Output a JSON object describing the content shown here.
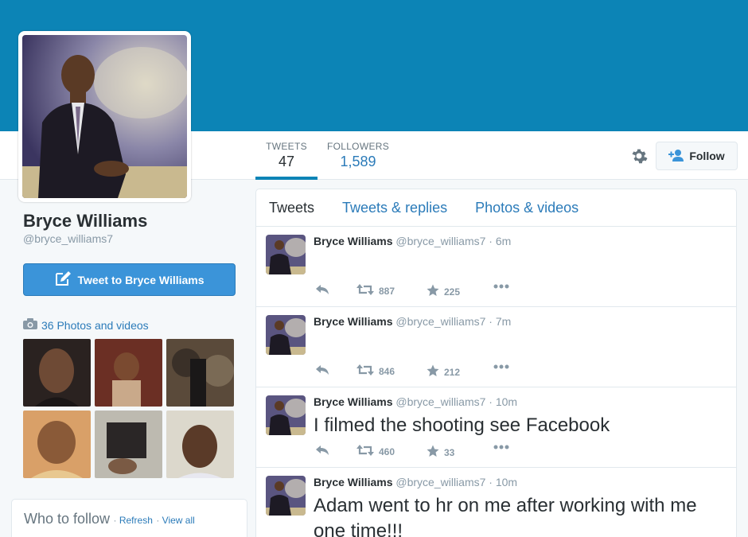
{
  "colors": {
    "banner": "#0c84b6",
    "link": "#2b7bb9",
    "button": "#3b94d9"
  },
  "stats": [
    {
      "label": "TWEETS",
      "value": "47"
    },
    {
      "label": "FOLLOWERS",
      "value": "1,589"
    }
  ],
  "follow_label": "Follow",
  "profile": {
    "name": "Bryce Williams",
    "handle": "@bryce_williams7",
    "tweet_to_label": "Tweet to Bryce Williams",
    "photos_label": "36 Photos and videos"
  },
  "who_to_follow": {
    "title": "Who to follow",
    "refresh": "Refresh",
    "view_all": "View all"
  },
  "tabs": [
    "Tweets",
    "Tweets & replies",
    "Photos & videos"
  ],
  "tweets": [
    {
      "name": "Bryce Williams",
      "handle": "@bryce_williams7",
      "time": "6m",
      "text": "",
      "retweets": "887",
      "favorites": "225"
    },
    {
      "name": "Bryce Williams",
      "handle": "@bryce_williams7",
      "time": "7m",
      "text": "",
      "retweets": "846",
      "favorites": "212"
    },
    {
      "name": "Bryce Williams",
      "handle": "@bryce_williams7",
      "time": "10m",
      "text": "I filmed the shooting see Facebook",
      "retweets": "460",
      "favorites": "33"
    },
    {
      "name": "Bryce Williams",
      "handle": "@bryce_williams7",
      "time": "10m",
      "text": "Adam went to hr on me after working with me one time!!!",
      "retweets": "",
      "favorites": ""
    }
  ],
  "icons": [
    "gear-icon",
    "add-user-icon",
    "compose-icon",
    "camera-icon",
    "reply-icon",
    "retweet-icon",
    "star-icon",
    "more-icon"
  ]
}
